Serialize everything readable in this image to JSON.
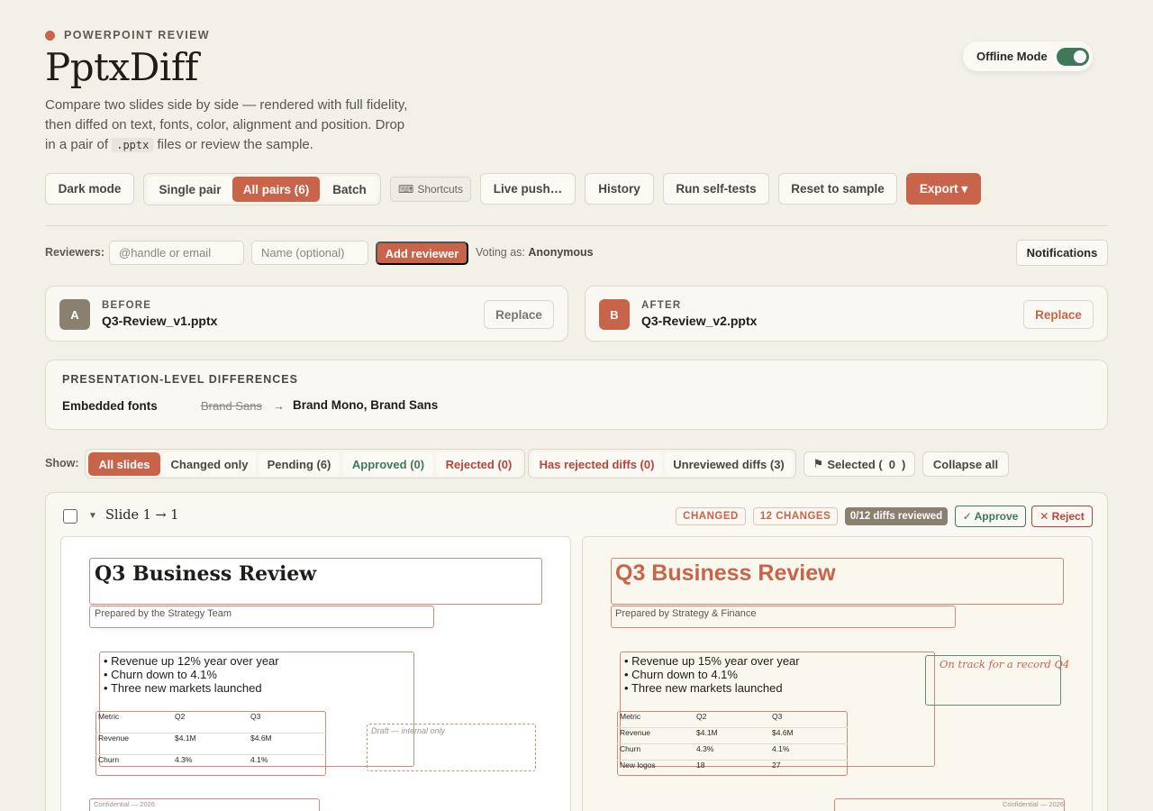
{
  "header": {
    "eyebrow": "POWERPOINT REVIEW",
    "title": "PptxDiff",
    "subtitle_pre": "Compare two slides side by side — rendered with full fidelity, then diffed on text, fonts, color, alignment and position. Drop in a pair of",
    "subtitle_code": ".pptx",
    "subtitle_post": "files or review the sample.",
    "offline_label": "Offline Mode"
  },
  "toolbar": {
    "dark_mode": "Dark mode",
    "single_pair": "Single pair",
    "all_pairs": "All pairs (6)",
    "batch": "Batch",
    "shortcuts": "Shortcuts",
    "live_push": "Live push…",
    "history": "History",
    "self_tests": "Run self-tests",
    "reset": "Reset to sample",
    "export": "Export ▾"
  },
  "reviewers": {
    "label": "Reviewers:",
    "handle_placeholder": "@handle or email",
    "name_placeholder": "Name (optional)",
    "add": "Add reviewer",
    "voting_prefix": "Voting as:",
    "voting_name": "Anonymous",
    "notifications": "Notifications"
  },
  "files": {
    "before": {
      "badge": "A",
      "label": "BEFORE",
      "name": "Q3-Review_v1.pptx",
      "replace": "Replace"
    },
    "after": {
      "badge": "B",
      "label": "AFTER",
      "name": "Q3-Review_v2.pptx",
      "replace": "Replace"
    }
  },
  "presentation": {
    "heading": "PRESENTATION-LEVEL DIFFERENCES",
    "key": "Embedded fonts",
    "old": "Brand Sans",
    "arrow": "→",
    "new": "Brand Mono, Brand Sans"
  },
  "filters": {
    "label": "Show:",
    "all": "All slides",
    "changed": "Changed only",
    "pending": "Pending (6)",
    "approved": "Approved (0)",
    "rejected": "Rejected (0)",
    "has_rejected": "Has rejected diffs (0)",
    "unreviewed": "Unreviewed diffs (3)",
    "selected_pre": "Selected (",
    "selected_count": "0",
    "selected_post": ")",
    "collapse": "Collapse all"
  },
  "slide": {
    "title": "Slide 1 → 1",
    "status": "CHANGED",
    "changes": "12 CHANGES",
    "reviewed": "0/12 diffs reviewed",
    "approve": "✓ Approve",
    "reject": "✕ Reject",
    "before": {
      "title": "Q3 Business Review",
      "subtitle": "Prepared by the Strategy Team",
      "bullets": [
        "Revenue up 12% year over year",
        "Churn down to 4.1%",
        "Three new markets launched"
      ],
      "table": [
        [
          "Metric",
          "Q2",
          "Q3"
        ],
        [
          "Revenue",
          "$4.1M",
          "$4.6M"
        ],
        [
          "Churn",
          "4.3%",
          "4.1%"
        ]
      ],
      "draft_note": "Draft — internal only",
      "footer": "Confidential — 2026"
    },
    "after": {
      "title": "Q3 Business Review",
      "subtitle": "Prepared by Strategy & Finance",
      "bullets": [
        "Revenue up 15% year over year",
        "Churn down to 4.1%",
        "Three new markets launched"
      ],
      "table": [
        [
          "Metric",
          "Q2",
          "Q3"
        ],
        [
          "Revenue",
          "$4.1M",
          "$4.6M"
        ],
        [
          "Churn",
          "4.3%",
          "4.1%"
        ],
        [
          "New logos",
          "18",
          "27"
        ]
      ],
      "callout": "On track for a record Q4",
      "footer": "Confidential — 2026"
    }
  },
  "colors": {
    "accent": "#c8644a",
    "green": "#3f7a58",
    "red": "#b8433b"
  }
}
